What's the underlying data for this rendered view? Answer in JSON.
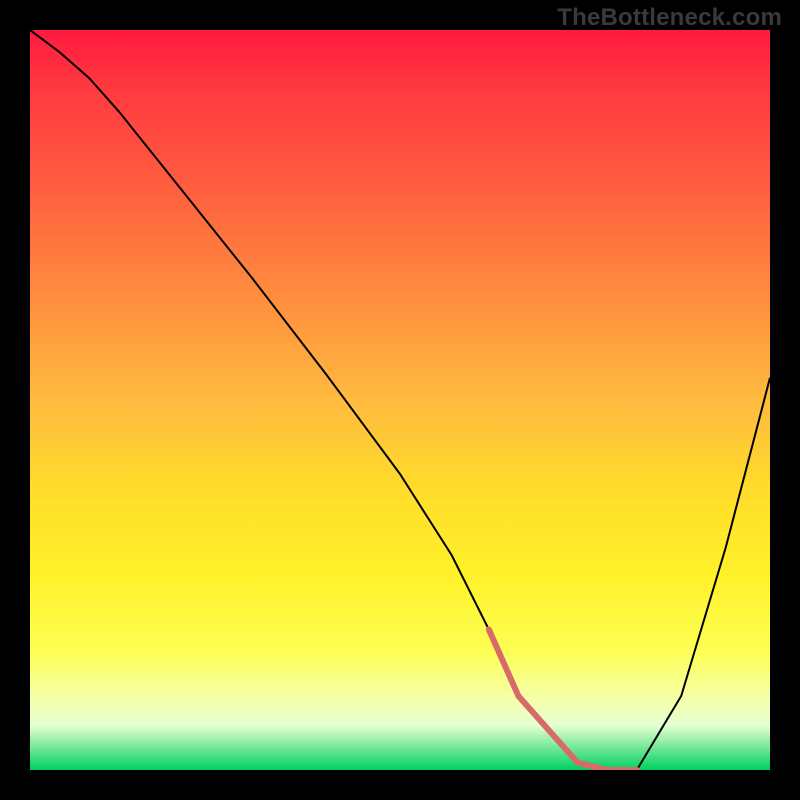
{
  "watermark": "TheBottleneck.com",
  "chart_data": {
    "type": "line",
    "title": "",
    "xlabel": "",
    "ylabel": "",
    "xlim": [
      0,
      100
    ],
    "ylim": [
      0,
      100
    ],
    "gradient_stops": [
      {
        "pos": 0,
        "color": "#ff1a3f"
      },
      {
        "pos": 8,
        "color": "#ff3a3f"
      },
      {
        "pos": 20,
        "color": "#ff5a3f"
      },
      {
        "pos": 30,
        "color": "#ff7a3f"
      },
      {
        "pos": 40,
        "color": "#ff9a3f"
      },
      {
        "pos": 50,
        "color": "#ffba3f"
      },
      {
        "pos": 62,
        "color": "#ffdc2a"
      },
      {
        "pos": 74,
        "color": "#fff22a"
      },
      {
        "pos": 84,
        "color": "#fdff55"
      },
      {
        "pos": 90,
        "color": "#f6ffa5"
      },
      {
        "pos": 94,
        "color": "#e5ffd0"
      },
      {
        "pos": 100,
        "color": "#00d060"
      }
    ],
    "series": [
      {
        "name": "bottleneck-curve",
        "color": "#000000",
        "stroke_width": 2,
        "x": [
          0,
          4,
          8,
          12,
          20,
          30,
          40,
          50,
          57,
          62,
          66,
          74,
          78,
          82,
          88,
          94,
          100
        ],
        "values": [
          100,
          97,
          93.5,
          89,
          79,
          66.5,
          53.5,
          40,
          29,
          19,
          10,
          1,
          0,
          0,
          10,
          30,
          53
        ]
      },
      {
        "name": "valley-highlight",
        "color": "#d96a6a",
        "stroke_width": 6,
        "x": [
          62,
          66,
          74,
          78,
          82
        ],
        "values": [
          19,
          10,
          1,
          0,
          0
        ]
      }
    ]
  }
}
